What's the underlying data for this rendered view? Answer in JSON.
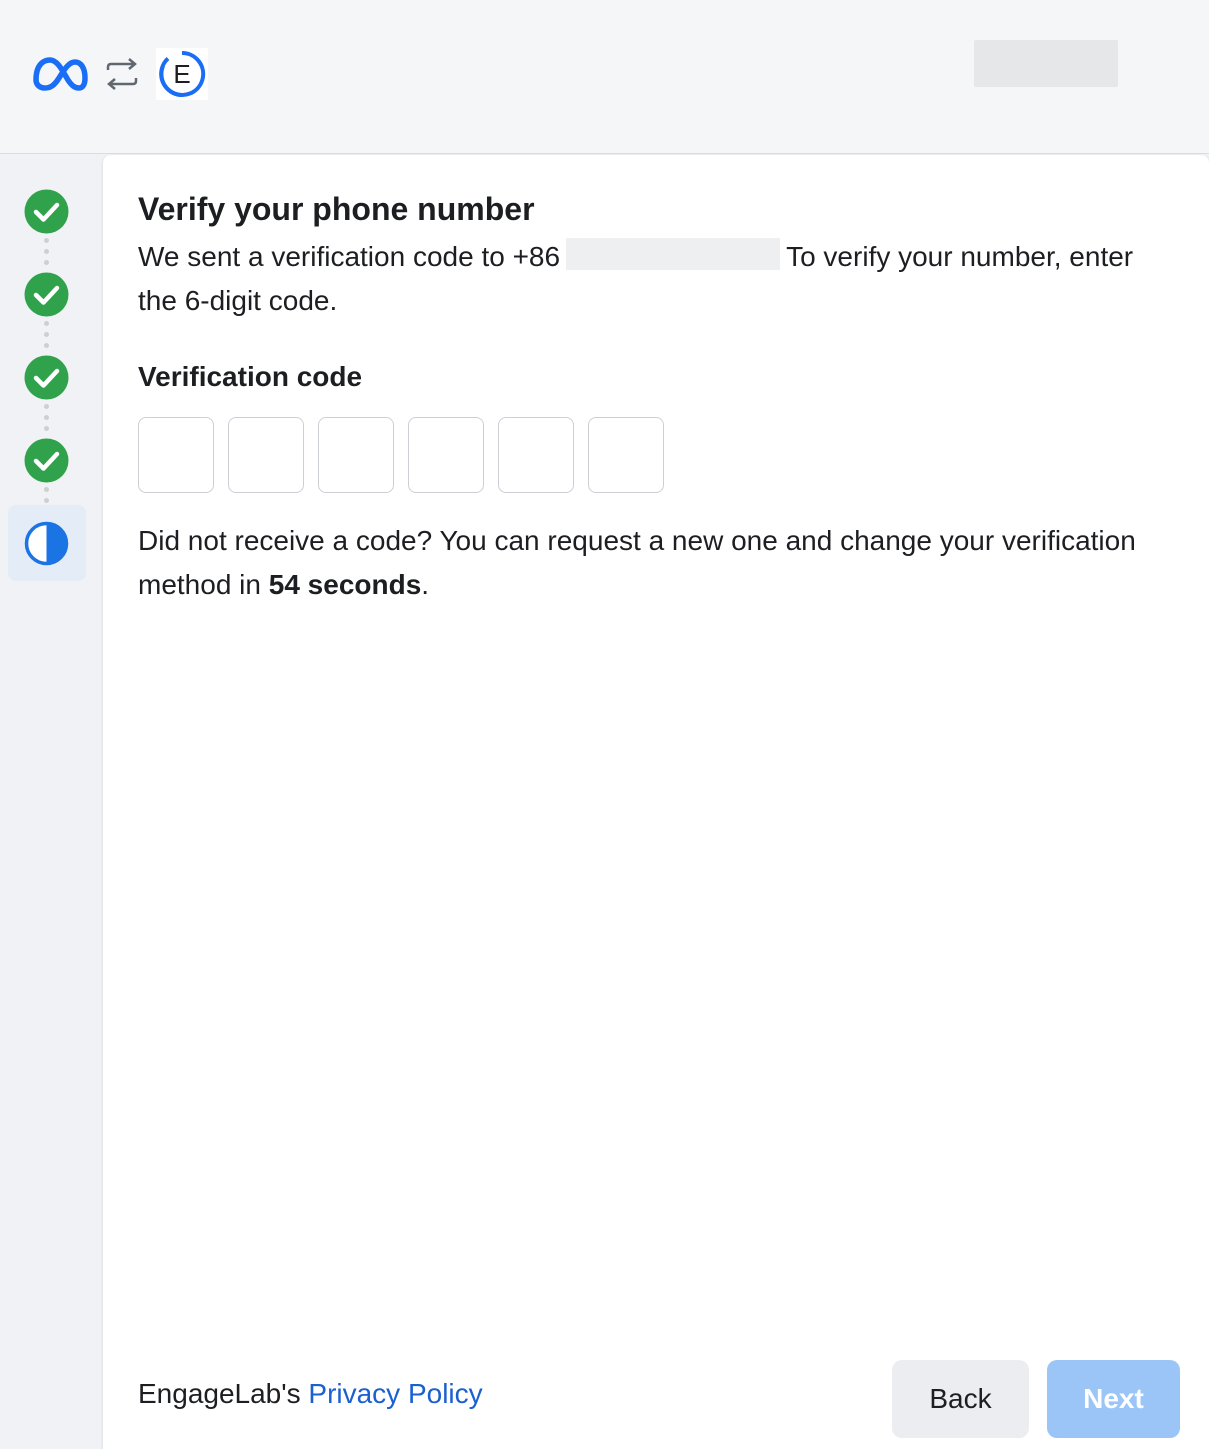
{
  "header": {
    "logos": [
      "meta-logo",
      "swap-arrows-icon",
      "engagelab-logo"
    ],
    "engagelab_letter": "E"
  },
  "steps": [
    {
      "status": "complete",
      "icon": "check-circle-icon"
    },
    {
      "status": "complete",
      "icon": "check-circle-icon"
    },
    {
      "status": "complete",
      "icon": "check-circle-icon"
    },
    {
      "status": "complete",
      "icon": "check-circle-icon"
    },
    {
      "status": "current",
      "icon": "half-circle-icon"
    }
  ],
  "panel": {
    "title": "Verify your phone number",
    "desc_prefix": "We sent a verification code to +86",
    "desc_suffix": "To verify your number, enter the 6-digit code.",
    "code_label": "Verification code",
    "code_values": [
      "",
      "",
      "",
      "",
      "",
      ""
    ],
    "resend_prefix": "Did not receive a code? You can request a new one and change your verification method in",
    "resend_countdown": "54 seconds",
    "resend_suffix": "."
  },
  "footer": {
    "brand_text": "EngageLab's",
    "privacy_link": "Privacy Policy",
    "back_label": "Back",
    "next_label": "Next"
  },
  "colors": {
    "accent": "#1b5fd0",
    "success": "#31a24c",
    "next_disabled": "#9cc5f7",
    "meta_blue": "#1a6ef5"
  }
}
